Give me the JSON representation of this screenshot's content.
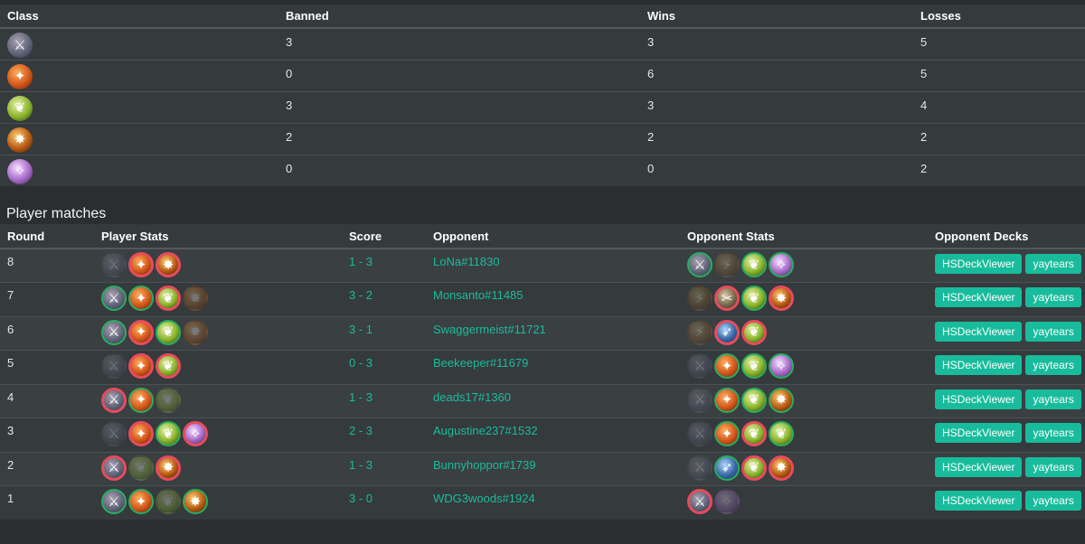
{
  "class_table": {
    "headers": [
      "Class",
      "Banned",
      "Wins",
      "Losses"
    ],
    "rows": [
      {
        "icon": "warrior-icon",
        "banned": "3",
        "wins": "3",
        "losses": "5"
      },
      {
        "icon": "mage-icon",
        "banned": "0",
        "wins": "6",
        "losses": "5"
      },
      {
        "icon": "druid-icon",
        "banned": "3",
        "wins": "3",
        "losses": "4"
      },
      {
        "icon": "warlock-icon",
        "banned": "2",
        "wins": "2",
        "losses": "2"
      },
      {
        "icon": "priest-icon",
        "banned": "0",
        "wins": "0",
        "losses": "2"
      }
    ]
  },
  "section_title": "Player matches",
  "match_table": {
    "headers": [
      "Round",
      "Player Stats",
      "Score",
      "Opponent",
      "Opponent Stats",
      "Opponent Decks"
    ],
    "rows": [
      {
        "round": "8",
        "score": "1 - 3",
        "opponent": "LoNa#11830",
        "player": [
          [
            "warrior",
            "dim"
          ],
          [
            "mage",
            "loss"
          ],
          [
            "warlock",
            "loss"
          ]
        ],
        "opp": [
          [
            "warrior",
            "win"
          ],
          [
            "shaman",
            "dim"
          ],
          [
            "druid",
            "win"
          ],
          [
            "priest",
            "win"
          ]
        ]
      },
      {
        "round": "7",
        "score": "3 - 2",
        "opponent": "Monsanto#11485",
        "player": [
          [
            "warrior",
            "win"
          ],
          [
            "mage",
            "win"
          ],
          [
            "druid",
            "loss"
          ],
          [
            "warlock",
            "dim"
          ]
        ],
        "opp": [
          [
            "shaman",
            "dim"
          ],
          [
            "rogue",
            "loss"
          ],
          [
            "druid",
            "win"
          ],
          [
            "warlock",
            "loss"
          ]
        ]
      },
      {
        "round": "6",
        "score": "3 - 1",
        "opponent": "Swaggermeist#11721",
        "player": [
          [
            "warrior",
            "win"
          ],
          [
            "mage",
            "loss"
          ],
          [
            "druid",
            "win"
          ],
          [
            "warlock",
            "dim"
          ]
        ],
        "opp": [
          [
            "shaman",
            "dim"
          ],
          [
            "hunter",
            "loss"
          ],
          [
            "druid",
            "loss"
          ]
        ]
      },
      {
        "round": "5",
        "score": "0 - 3",
        "opponent": "Beekeeper#11679",
        "player": [
          [
            "warrior",
            "dim"
          ],
          [
            "mage",
            "loss"
          ],
          [
            "druid",
            "loss"
          ]
        ],
        "opp": [
          [
            "warrior",
            "dim"
          ],
          [
            "mage",
            "win"
          ],
          [
            "druid",
            "win"
          ],
          [
            "priest",
            "win"
          ]
        ]
      },
      {
        "round": "4",
        "score": "1 - 3",
        "opponent": "deads17#1360",
        "player": [
          [
            "warrior",
            "loss"
          ],
          [
            "mage",
            "win"
          ],
          [
            "druid",
            "dim"
          ]
        ],
        "opp": [
          [
            "warrior",
            "dim"
          ],
          [
            "mage",
            "win"
          ],
          [
            "druid",
            "win"
          ],
          [
            "warlock",
            "win"
          ]
        ]
      },
      {
        "round": "3",
        "score": "2 - 3",
        "opponent": "Augustine237#1532",
        "player": [
          [
            "warrior",
            "dim"
          ],
          [
            "mage",
            "loss"
          ],
          [
            "druid",
            "win"
          ],
          [
            "priest",
            "loss"
          ]
        ],
        "opp": [
          [
            "warrior",
            "dim"
          ],
          [
            "mage",
            "win"
          ],
          [
            "druid",
            "loss"
          ],
          [
            "druid",
            "win"
          ]
        ]
      },
      {
        "round": "2",
        "score": "1 - 3",
        "opponent": "Bunnyhoppor#1739",
        "player": [
          [
            "warrior",
            "loss"
          ],
          [
            "druid",
            "dim"
          ],
          [
            "warlock",
            "loss"
          ]
        ],
        "opp": [
          [
            "warrior",
            "dim"
          ],
          [
            "hunter",
            "win"
          ],
          [
            "druid",
            "loss"
          ],
          [
            "warlock",
            "loss"
          ]
        ]
      },
      {
        "round": "1",
        "score": "3 - 0",
        "opponent": "WDG3woods#1924",
        "player": [
          [
            "warrior",
            "win"
          ],
          [
            "mage",
            "win"
          ],
          [
            "druid",
            "dim"
          ],
          [
            "warlock",
            "win"
          ]
        ],
        "opp": [
          [
            "warrior",
            "loss"
          ],
          [
            "priest",
            "dim"
          ]
        ]
      }
    ],
    "deck_buttons": [
      "HSDeckViewer",
      "yaytears"
    ]
  }
}
